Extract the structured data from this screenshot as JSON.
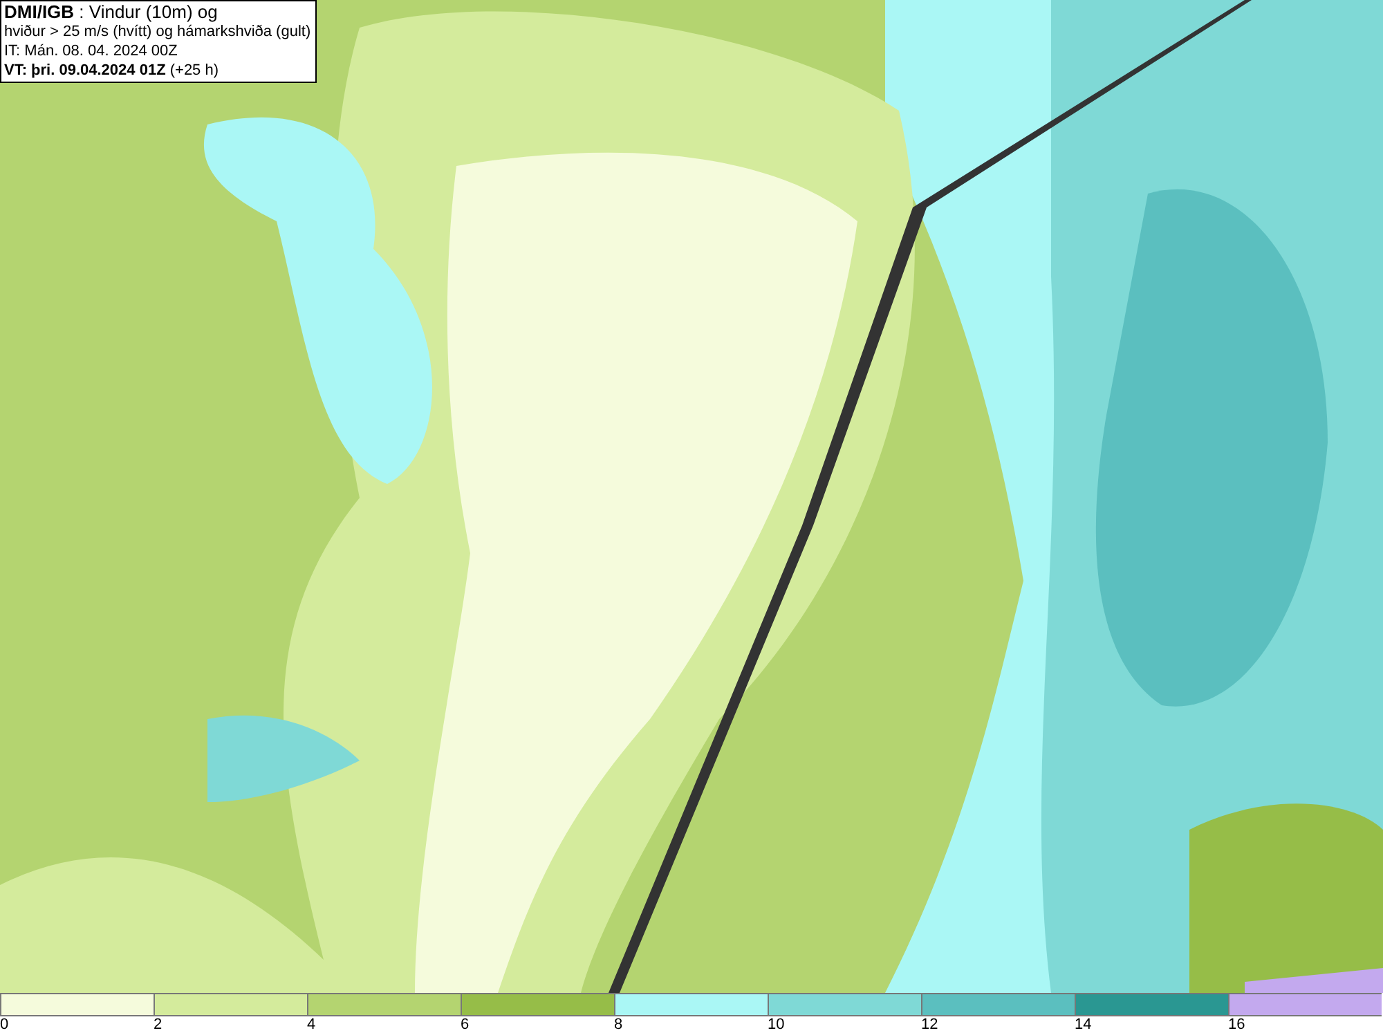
{
  "title_box": {
    "lines": [
      "**DMI/IGB** : Vindur (10m) og",
      "hviður > 25 m/s (hvítt) og hámarkshviða (gult)",
      "IT: Mán. 08. 04. 2024 00Z",
      "**VT: þri. 09.04.2024 01Z** (+25 h)"
    ]
  },
  "legend": [
    {
      "label": "0",
      "color": "#f5fbdc"
    },
    {
      "label": "2",
      "color": "#d4eb9c"
    },
    {
      "label": "4",
      "color": "#b4d470"
    },
    {
      "label": "6",
      "color": "#96bd48"
    },
    {
      "label": "8",
      "color": "#aaf7f5"
    },
    {
      "label": "10",
      "color": "#7fd9d6"
    },
    {
      "label": "12",
      "color": "#5bbfbf"
    },
    {
      "label": "14",
      "color": "#2a9792"
    },
    {
      "label": "16",
      "color": "#c3a9ee"
    }
  ]
}
